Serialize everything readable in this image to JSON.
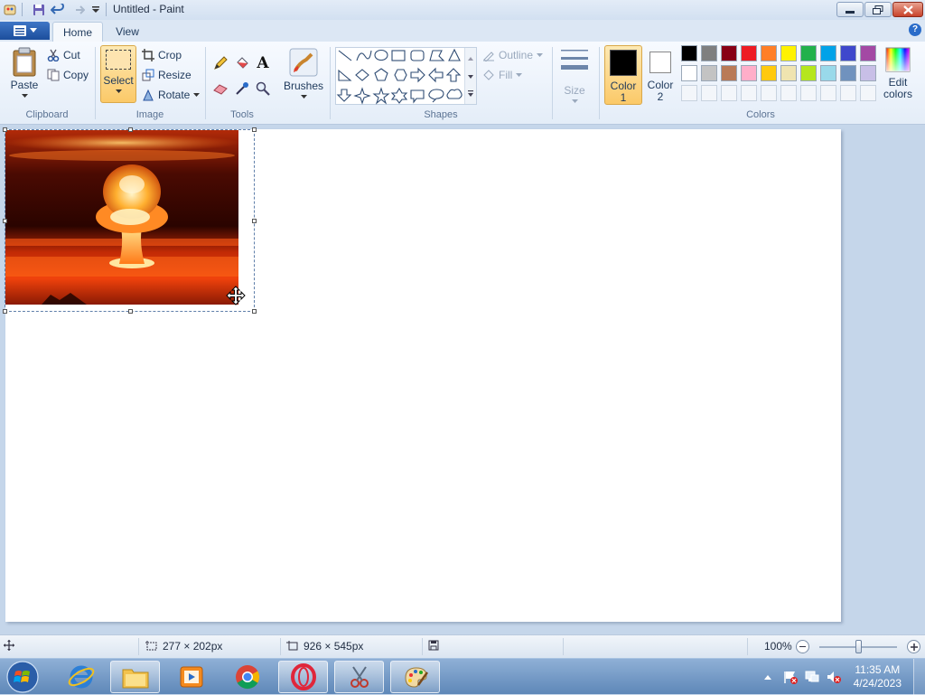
{
  "window": {
    "title": "Untitled - Paint"
  },
  "tabs": [
    {
      "label": "Home"
    },
    {
      "label": "View"
    }
  ],
  "ribbon": {
    "clipboard": {
      "group": "Clipboard",
      "paste": "Paste",
      "cut": "Cut",
      "copy": "Copy"
    },
    "image": {
      "group": "Image",
      "select": "Select",
      "crop": "Crop",
      "resize": "Resize",
      "rotate": "Rotate"
    },
    "tools": {
      "group": "Tools"
    },
    "brushes": {
      "label": "Brushes"
    },
    "shapes": {
      "group": "Shapes",
      "outline": "Outline",
      "fill": "Fill"
    },
    "size": {
      "label": "Size"
    },
    "colors": {
      "group": "Colors",
      "color1_line1": "Color",
      "color1_line2": "1",
      "color2_line1": "Color",
      "color2_line2": "2",
      "edit_line1": "Edit",
      "edit_line2": "colors",
      "color1": "#000000",
      "color2": "#ffffff",
      "palette_row1": [
        "#000000",
        "#7f7f7f",
        "#880015",
        "#ed1c24",
        "#ff7f27",
        "#fff200",
        "#22b14c",
        "#00a2e8",
        "#3f48cc",
        "#a349a4"
      ],
      "palette_row2": [
        "#ffffff",
        "#c3c3c3",
        "#b97a57",
        "#ffaec9",
        "#ffc90e",
        "#efe4b0",
        "#b5e61d",
        "#99d9ea",
        "#7092be",
        "#c8bfe7"
      ]
    }
  },
  "status": {
    "selection_size": "277 × 202px",
    "canvas_size": "926 × 545px",
    "zoom": "100%",
    "zoom_level": 1.0
  },
  "taskbar": {
    "time": "11:35 AM",
    "date": "4/24/2023"
  },
  "colors": {
    "accent": "#1c4e9c",
    "selected_button": "#fcd88a"
  }
}
